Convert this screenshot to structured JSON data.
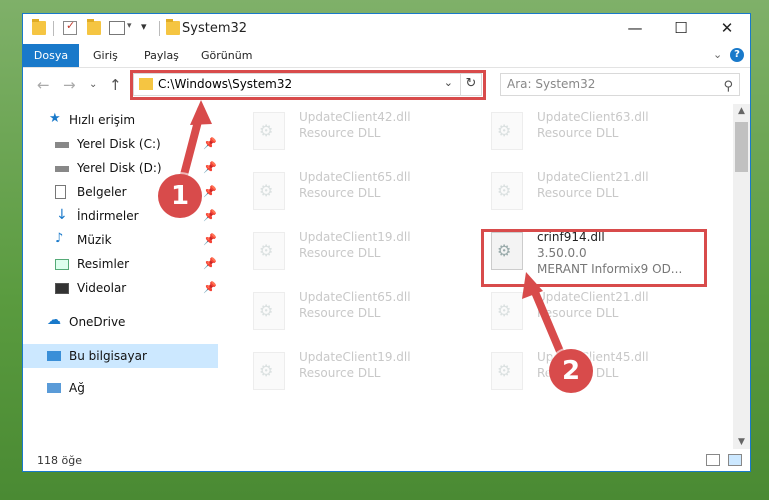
{
  "window": {
    "title": "System32",
    "controls": {
      "minimize": "—",
      "maximize": "☐",
      "close": "✕"
    }
  },
  "ribbon": {
    "tabs": [
      "Dosya",
      "Giriş",
      "Paylaş",
      "Görünüm"
    ],
    "help": "?"
  },
  "nav": {
    "address": "C:\\Windows\\System32",
    "search_placeholder": "Ara: System32"
  },
  "sidebar": {
    "quick_access": "Hızlı erişim",
    "items": [
      {
        "label": "Yerel Disk (C:)",
        "icon": "drive-icon"
      },
      {
        "label": "Yerel Disk (D:)",
        "icon": "drive-icon"
      },
      {
        "label": "Belgeler",
        "icon": "documents-icon"
      },
      {
        "label": "İndirmeler",
        "icon": "downloads-icon"
      },
      {
        "label": "Müzik",
        "icon": "music-icon"
      },
      {
        "label": "Resimler",
        "icon": "pictures-icon"
      },
      {
        "label": "Videolar",
        "icon": "videos-icon"
      }
    ],
    "onedrive": "OneDrive",
    "this_pc": "Bu bilgisayar",
    "network": "Ağ"
  },
  "files": [
    {
      "name": "UpdateClient42.dll",
      "desc": "Resource DLL"
    },
    {
      "name": "UpdateClient63.dll",
      "desc": "Resource DLL"
    },
    {
      "name": "UpdateClient65.dll",
      "desc": "Resource DLL"
    },
    {
      "name": "UpdateClient21.dll",
      "desc": "Resource DLL"
    },
    {
      "name": "UpdateClient19.dll",
      "desc": "Resource DLL"
    },
    {
      "name": "crinf914.dll",
      "desc": "3.50.0.0",
      "extra": "MERANT Informix9 OD..."
    },
    {
      "name": "UpdateClient65.dll",
      "desc": "Resource DLL"
    },
    {
      "name": "UpdateClient21.dll",
      "desc": "Resource DLL"
    },
    {
      "name": "UpdateClient19.dll",
      "desc": "Resource DLL"
    },
    {
      "name": "UpdateClient45.dll",
      "desc": "Resource DLL"
    }
  ],
  "status": {
    "count": "118 öğe"
  },
  "callouts": [
    "1",
    "2"
  ],
  "colors": {
    "accent": "#1979ca",
    "highlight": "#d84b4b",
    "selected": "#cce8ff"
  }
}
